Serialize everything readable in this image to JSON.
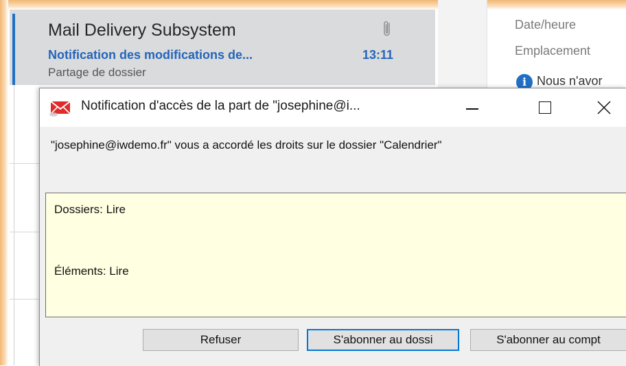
{
  "mail_list": {
    "selected_item": {
      "sender": "Mail Delivery Subsystem",
      "subject": "Notification des modifications de...",
      "time": "13:11",
      "preview": "Partage de dossier",
      "attachment_icon": "paperclip-icon"
    }
  },
  "reading_pane": {
    "date_label": "Date/heure",
    "location_label": "Emplacement",
    "info_icon": "info-icon",
    "info_text": "Nous n'avor"
  },
  "dialog": {
    "title": "Notification d'accès de la part de \"josephine@i...",
    "message": "\"josephine@iwdemo.fr\" vous a accordé les droits sur le dossier \"Calendrier\"",
    "rights": {
      "folders": "Dossiers: Lire",
      "items": "Éléments: Lire"
    },
    "buttons": {
      "refuse": "Refuser",
      "subscribe_folder": "S'abonner  au dossi",
      "subscribe_account": "S'abonner  au compt"
    },
    "window_controls": [
      "minimize-icon",
      "maximize-icon",
      "close-icon"
    ]
  },
  "colors": {
    "accent_blue": "#1f6fc5",
    "subject_blue": "#2465bb",
    "rights_background": "#ffffe1",
    "highlight_frame": "#f2b773",
    "title_icon_red": "#e02b2b"
  }
}
